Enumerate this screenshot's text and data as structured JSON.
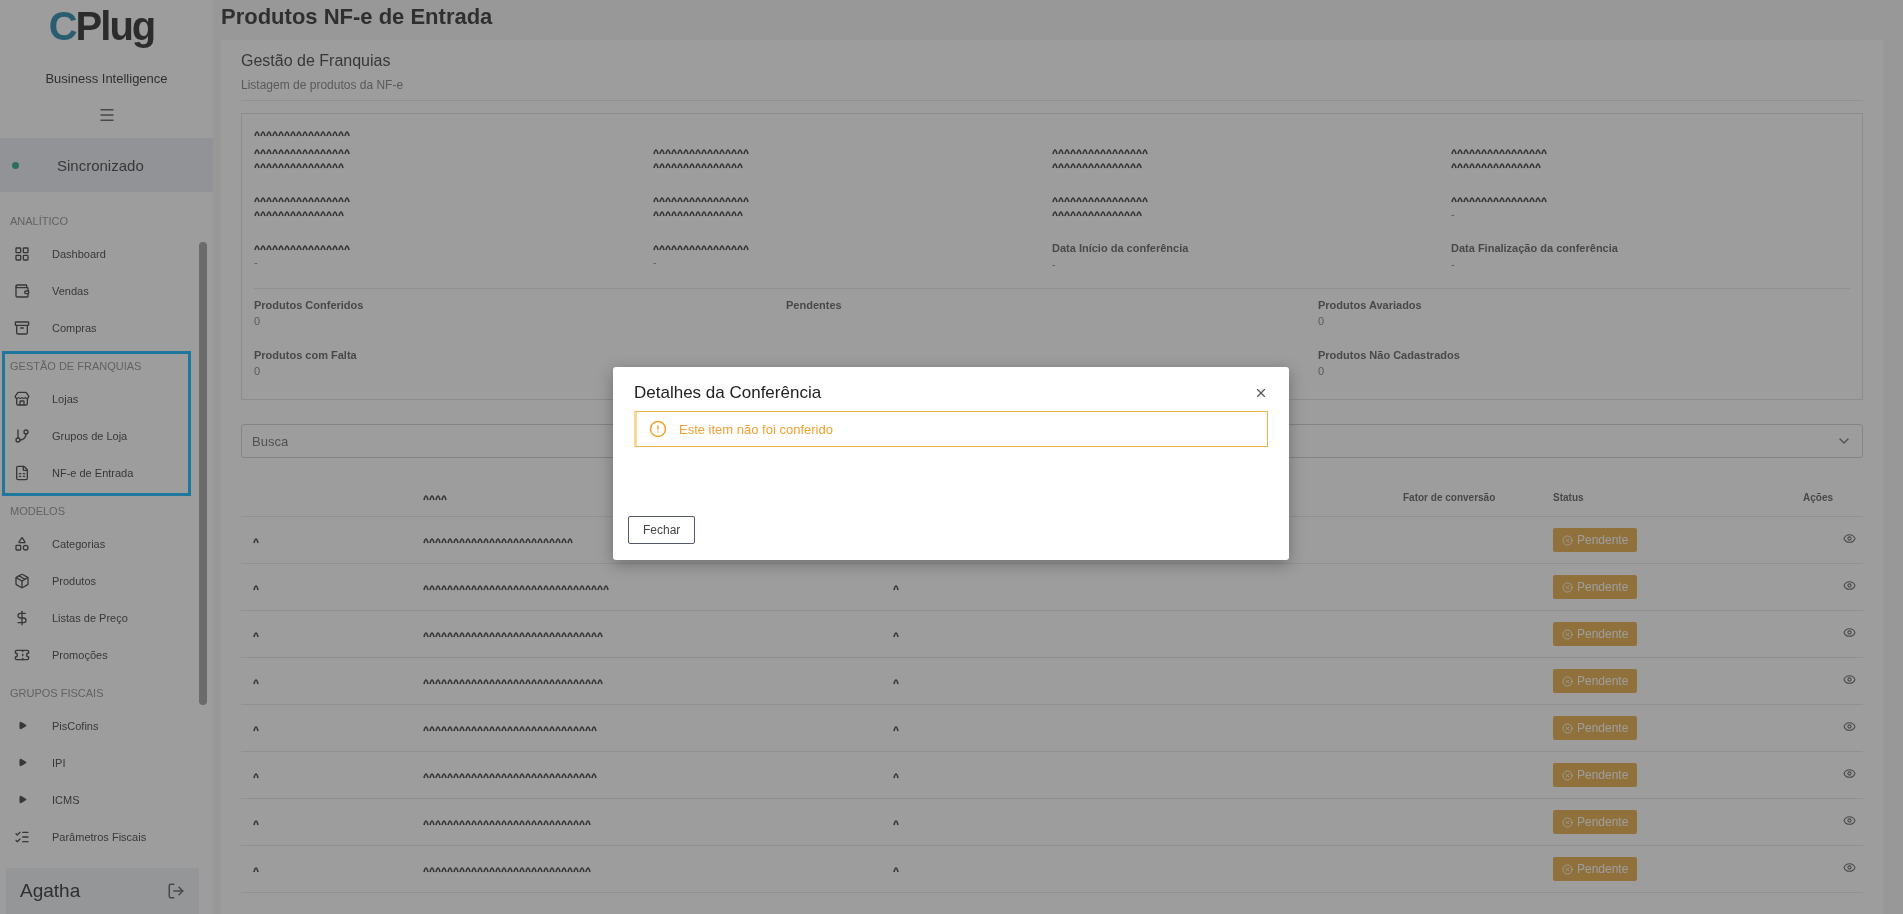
{
  "sidebar": {
    "logo_text": "CPlug",
    "subtitle": "Business Intelligence",
    "sync_status": {
      "label": "Sincronizado"
    },
    "sections": [
      {
        "title": "ANALÍTICO",
        "highlighted": false,
        "items": [
          {
            "label": "Dashboard"
          },
          {
            "label": "Vendas"
          },
          {
            "label": "Compras"
          }
        ]
      },
      {
        "title": "GESTÃO DE FRANQUIAS",
        "highlighted": true,
        "items": [
          {
            "label": "Lojas"
          },
          {
            "label": "Grupos de Loja"
          },
          {
            "label": "NF-e de Entrada"
          }
        ]
      },
      {
        "title": "MODELOS",
        "highlighted": false,
        "items": [
          {
            "label": "Categorias"
          },
          {
            "label": "Produtos"
          },
          {
            "label": "Listas de Preço"
          },
          {
            "label": "Promoções"
          }
        ]
      },
      {
        "title": "GRUPOS FISCAIS",
        "highlighted": false,
        "items": [
          {
            "label": "PisCofins"
          },
          {
            "label": "IPI"
          },
          {
            "label": "ICMS"
          },
          {
            "label": "Parâmetros Fiscais"
          }
        ]
      }
    ],
    "user": {
      "name": "Agatha"
    }
  },
  "page": {
    "title": "Produtos NF-e de Entrada",
    "card_title": "Gestão de Franquias",
    "card_subtitle": "Listagem de produtos da NF-e",
    "info_fields": [
      {
        "kind": "redacted"
      },
      {
        "kind": "redacted"
      },
      {
        "kind": "redacted"
      },
      {
        "kind": "redacted"
      },
      {
        "kind": "redacted"
      },
      {
        "kind": "redacted"
      },
      {
        "kind": "redacted"
      },
      {
        "kind": "redacted",
        "value": "-"
      },
      {
        "kind": "redacted",
        "value": "-"
      },
      {
        "kind": "redacted",
        "value": "-"
      },
      {
        "kind": "text",
        "label": "Data Início da conferência",
        "value": "-"
      },
      {
        "kind": "text",
        "label": "Data Finalização da conferência",
        "value": "-"
      }
    ],
    "counters": [
      {
        "label": "Produtos Conferidos",
        "value": "0"
      },
      {
        "label": "Pendentes"
      },
      {
        "label": "Produtos Avariados",
        "value": "0"
      },
      {
        "label": "Produtos com Falta",
        "value": "0"
      },
      {
        "label": "Produtos Não Cadastrados",
        "value": "0"
      }
    ],
    "search": {
      "placeholder": "Busca"
    },
    "table": {
      "columns": [
        "Fator de conversão",
        "Status",
        "Ações"
      ],
      "rows": [
        {
          "status": "Pendente"
        },
        {
          "status": "Pendente"
        },
        {
          "status": "Pendente"
        },
        {
          "status": "Pendente"
        },
        {
          "status": "Pendente"
        },
        {
          "status": "Pendente"
        },
        {
          "status": "Pendente"
        },
        {
          "status": "Pendente"
        }
      ]
    }
  },
  "modal": {
    "title": "Detalhes da Conferência",
    "alert": "Este item não foi conferido",
    "button": "Fechar"
  }
}
